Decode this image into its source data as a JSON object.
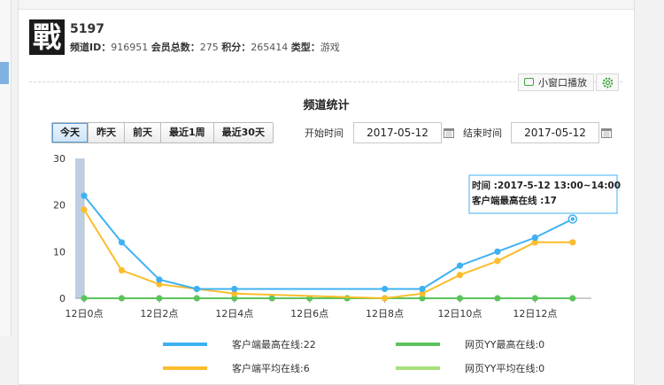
{
  "channel": {
    "logo_char": "戰",
    "name": "5197",
    "id_label": "频道ID：",
    "id_value": "916951",
    "members_label": "会员总数：",
    "members_value": "275",
    "points_label": "积分：",
    "points_value": "265414",
    "type_label": "类型：",
    "type_value": "游戏"
  },
  "toolbar": {
    "mini_player_label": "小窗口播放",
    "mini_player_icon": "tv-icon",
    "settings_icon": "gear-icon",
    "accent": "#3fa63f"
  },
  "stats": {
    "title": "频道统计",
    "ranges": [
      "今天",
      "昨天",
      "前天",
      "最近1周",
      "最近30天"
    ],
    "active_range": "今天",
    "start_label": "开始时间",
    "start_value": "2017-05-12",
    "end_label": "结束时间",
    "end_value": "2017-05-12",
    "calendar_icon": "calendar-icon"
  },
  "chart_data": {
    "type": "line",
    "ylim": [
      0,
      30
    ],
    "yticks": [
      0,
      10,
      20,
      30
    ],
    "xlim": [
      0,
      13.5
    ],
    "xticks": [
      {
        "x": 0,
        "label": "12日0点"
      },
      {
        "x": 2,
        "label": "12日2点"
      },
      {
        "x": 4,
        "label": "12日4点"
      },
      {
        "x": 6,
        "label": "12日6点"
      },
      {
        "x": 8,
        "label": "12日8点"
      },
      {
        "x": 10,
        "label": "12日10点"
      },
      {
        "x": 12,
        "label": "12日12点"
      }
    ],
    "grid": false,
    "series": [
      {
        "name": "客户端最高在线",
        "color": "#3fb1f2",
        "points": [
          [
            0,
            22
          ],
          [
            1,
            12
          ],
          [
            2,
            4
          ],
          [
            3,
            2
          ],
          [
            4,
            2
          ],
          [
            8,
            2
          ],
          [
            9,
            2
          ],
          [
            10,
            7
          ],
          [
            11,
            10
          ],
          [
            12,
            13
          ],
          [
            13,
            17
          ]
        ]
      },
      {
        "name": "客户端平均在线",
        "color": "#fbbd2c",
        "points": [
          [
            0,
            19
          ],
          [
            1,
            6
          ],
          [
            2,
            3
          ],
          [
            3,
            2
          ],
          [
            4,
            1
          ],
          [
            8,
            0
          ],
          [
            9,
            1
          ],
          [
            10,
            5
          ],
          [
            11,
            8
          ],
          [
            12,
            12
          ],
          [
            13,
            12
          ]
        ]
      },
      {
        "name": "网页YY最高在线",
        "color": "#5cc35c",
        "points": [
          [
            0,
            0
          ],
          [
            1,
            0
          ],
          [
            2,
            0
          ],
          [
            3,
            0
          ],
          [
            4,
            0
          ],
          [
            5,
            0
          ],
          [
            6,
            0
          ],
          [
            7,
            0
          ],
          [
            8,
            0
          ],
          [
            9,
            0
          ],
          [
            10,
            0
          ],
          [
            11,
            0
          ],
          [
            12,
            0
          ],
          [
            13,
            0
          ]
        ]
      },
      {
        "name": "网页YY平均在线",
        "color": "#a8e07c",
        "points": [
          [
            0,
            0
          ],
          [
            13,
            0
          ]
        ]
      }
    ],
    "highlight_band_x": 0,
    "tooltip": {
      "line1": "时间 :2017-5-12 13:00~14:00",
      "line2": "客户端最高在线 :17",
      "point": [
        13,
        17
      ]
    },
    "legend": [
      {
        "label": "客户端最高在线:22",
        "color": "#3fb1f2"
      },
      {
        "label": "网页YY最高在线:0",
        "color": "#5cc35c"
      },
      {
        "label": "客户端平均在线:6",
        "color": "#fbbd2c"
      },
      {
        "label": "网页YY平均在线:0",
        "color": "#a8e07c"
      }
    ]
  }
}
